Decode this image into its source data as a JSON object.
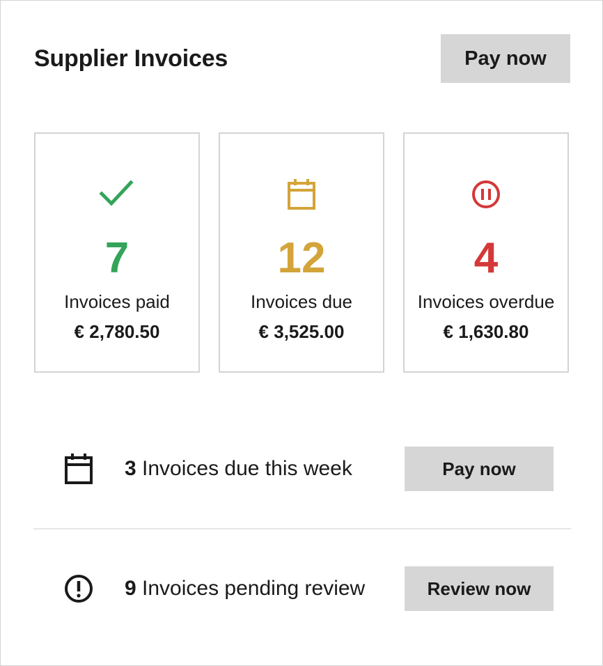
{
  "header": {
    "title": "Supplier Invoices",
    "pay_now_label": "Pay now"
  },
  "colors": {
    "paid": "#34a45a",
    "due": "#d3a43a",
    "overdue": "#d43838",
    "button_bg": "#d6d6d6"
  },
  "cards": [
    {
      "icon": "check-icon",
      "count": "7",
      "label": "Invoices paid",
      "amount": "€ 2,780.50"
    },
    {
      "icon": "calendar-icon",
      "count": "12",
      "label": "Invoices due",
      "amount": "€ 3,525.00"
    },
    {
      "icon": "pause-circle-icon",
      "count": "4",
      "label": "Invoices overdue",
      "amount": "€ 1,630.80"
    }
  ],
  "actions": [
    {
      "icon": "calendar-icon",
      "count": "3",
      "text": "Invoices due this week",
      "button_label": "Pay now"
    },
    {
      "icon": "alert-circle-icon",
      "count": "9",
      "text": "Invoices pending review",
      "button_label": "Review now"
    }
  ]
}
